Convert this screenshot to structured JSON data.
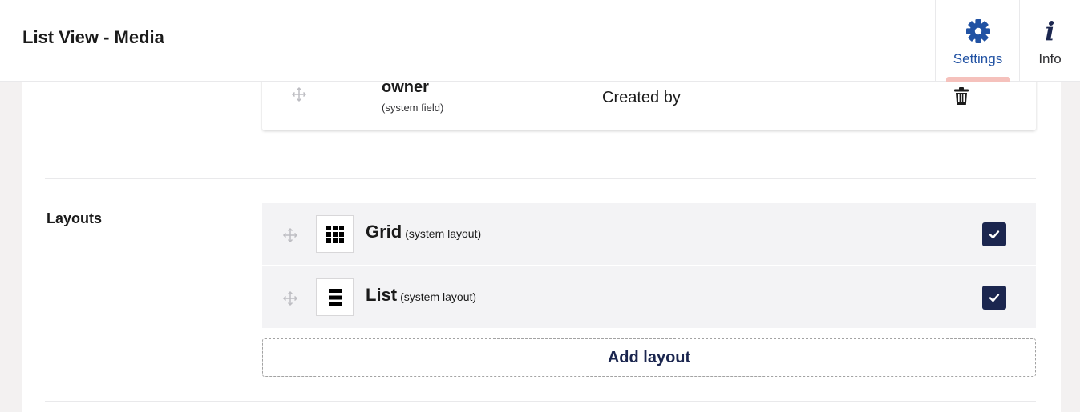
{
  "header": {
    "title": "List View - Media",
    "apps": [
      {
        "label": "Settings",
        "icon": "gear-icon",
        "active": true
      },
      {
        "label": "Info",
        "icon": "info-icon",
        "active": false
      }
    ]
  },
  "columns": {
    "items": [
      {
        "alias": "owner",
        "note": "(system field)",
        "header": "Created by"
      }
    ]
  },
  "layouts": {
    "label": "Layouts",
    "items": [
      {
        "name": "Grid",
        "note": "(system layout)",
        "icon": "grid-icon",
        "checked": true
      },
      {
        "name": "List",
        "note": "(system layout)",
        "icon": "list-icon",
        "checked": true
      }
    ],
    "add_label": "Add layout"
  },
  "colors": {
    "accent": "#1b264f",
    "settings_blue": "#2152a3",
    "active_indicator": "#f5c1bc"
  }
}
